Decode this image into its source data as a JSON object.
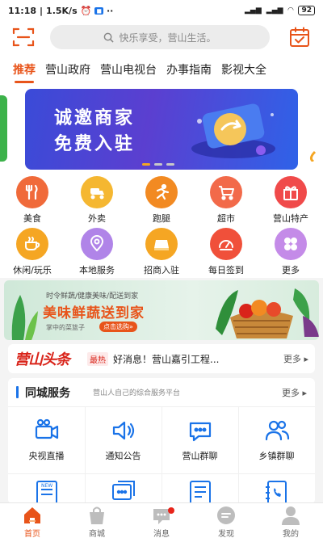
{
  "statusbar": {
    "time": "11:18",
    "speed": "1.5K/s",
    "battery": "92"
  },
  "header": {
    "search_placeholder": "快乐享受，营山生活。"
  },
  "tabs": [
    {
      "label": "推荐",
      "active": true
    },
    {
      "label": "营山政府"
    },
    {
      "label": "营山电视台"
    },
    {
      "label": "办事指南"
    },
    {
      "label": "影视大全"
    }
  ],
  "banner": {
    "line1": "诚邀商家",
    "line2": "免费入驻",
    "colors": {
      "from": "#3a4bd8",
      "to": "#2f62e8"
    }
  },
  "grid": [
    {
      "label": "美食",
      "icon": "fork-knife-icon",
      "color": "#f06a3a"
    },
    {
      "label": "外卖",
      "icon": "scooter-icon",
      "color": "#f5b731"
    },
    {
      "label": "跑腿",
      "icon": "runner-icon",
      "color": "#f28a22"
    },
    {
      "label": "超市",
      "icon": "cart-icon",
      "color": "#f26a4a"
    },
    {
      "label": "营山特产",
      "icon": "gift-icon",
      "color": "#f04a4a"
    },
    {
      "label": "休闲/玩乐",
      "icon": "coffee-icon",
      "color": "#f5a623"
    },
    {
      "label": "本地服务",
      "icon": "location-icon",
      "color": "#b084e8"
    },
    {
      "label": "招商入驻",
      "icon": "storefront-icon",
      "color": "#f5a623"
    },
    {
      "label": "每日签到",
      "icon": "speedometer-icon",
      "color": "#f0503a"
    },
    {
      "label": "更多",
      "icon": "clover-icon",
      "color": "#c48be8"
    }
  ],
  "promo": {
    "tagline": "时令鲜蔬/健康美味/配送到家",
    "title": "美味鲜蔬送到家",
    "subtitle": "掌中的菜篮子",
    "cta": "点击选购»"
  },
  "headline": {
    "logo_a": "营山",
    "logo_b": "头条",
    "tag": "最热",
    "text": "好消息！营山嘉引工程...",
    "more": "更多 ▸"
  },
  "service": {
    "title": "同城服务",
    "subtitle": "营山人自己的综合服务平台",
    "more": "更多 ▸",
    "items": [
      {
        "label": "央视直播",
        "icon": "camera-icon"
      },
      {
        "label": "通知公告",
        "icon": "speaker-icon"
      },
      {
        "label": "营山群聊",
        "icon": "chat-bubble-icon"
      },
      {
        "label": "乡镇群聊",
        "icon": "users-icon"
      }
    ]
  },
  "bottomnav": [
    {
      "label": "首页",
      "icon": "home-icon",
      "active": true
    },
    {
      "label": "商城",
      "icon": "shopping-bag-icon"
    },
    {
      "label": "消息",
      "icon": "message-icon",
      "has_badge": true
    },
    {
      "label": "发现",
      "icon": "compass-icon"
    },
    {
      "label": "我的",
      "icon": "person-icon"
    }
  ],
  "colors": {
    "accent": "#e8541a",
    "service_blue": "#1a73e8"
  }
}
